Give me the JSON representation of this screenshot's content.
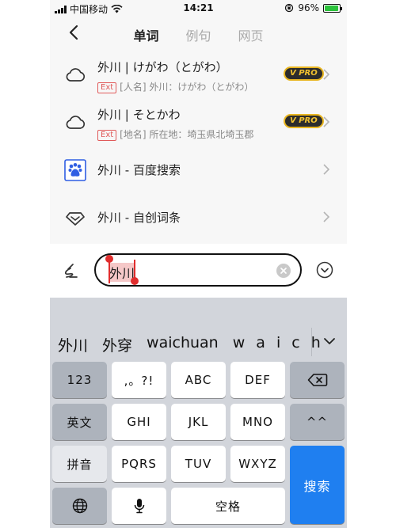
{
  "status_bar": {
    "carrier": "中国移动",
    "time": "14:21",
    "battery_percent": "96%",
    "battery_level": 0.96
  },
  "nav": {
    "tabs": [
      {
        "label": "单词",
        "active": true
      },
      {
        "label": "例句",
        "active": false
      },
      {
        "label": "网页",
        "active": false
      }
    ]
  },
  "results": [
    {
      "icon": "cloud-icon",
      "title": "外川 | けがわ（とがわ）",
      "tag": "Ext",
      "desc": "[人名] 外川：けがわ（とがわ）",
      "badge": "V PRO"
    },
    {
      "icon": "cloud-icon",
      "title": "外川 | そとかわ",
      "tag": "Ext",
      "desc": "[地名] 所在地：埼玉県北埼玉郡",
      "badge": "V PRO"
    },
    {
      "icon": "baidu-paw-icon",
      "title": "外川 - 百度搜索"
    },
    {
      "icon": "diamond-icon",
      "title": "外川 - 自创词条"
    }
  ],
  "search": {
    "value": "外川"
  },
  "keyboard": {
    "candidates": [
      "外川",
      "外穿",
      "waichuan",
      "w a i c h"
    ],
    "rows": [
      [
        "123",
        ",。?!",
        "ABC",
        "DEF",
        "backspace"
      ],
      [
        "英文",
        "GHI",
        "JKL",
        "MNO",
        "^^"
      ],
      [
        "拼音",
        "PQRS",
        "TUV",
        "WXYZ"
      ],
      [
        "globe",
        "mic",
        "空格"
      ]
    ],
    "search_label": "搜索"
  },
  "colors": {
    "accent_red": "#f25a5a",
    "search_blue": "#1f7ff0",
    "vpro_gold": "#e9b620"
  }
}
